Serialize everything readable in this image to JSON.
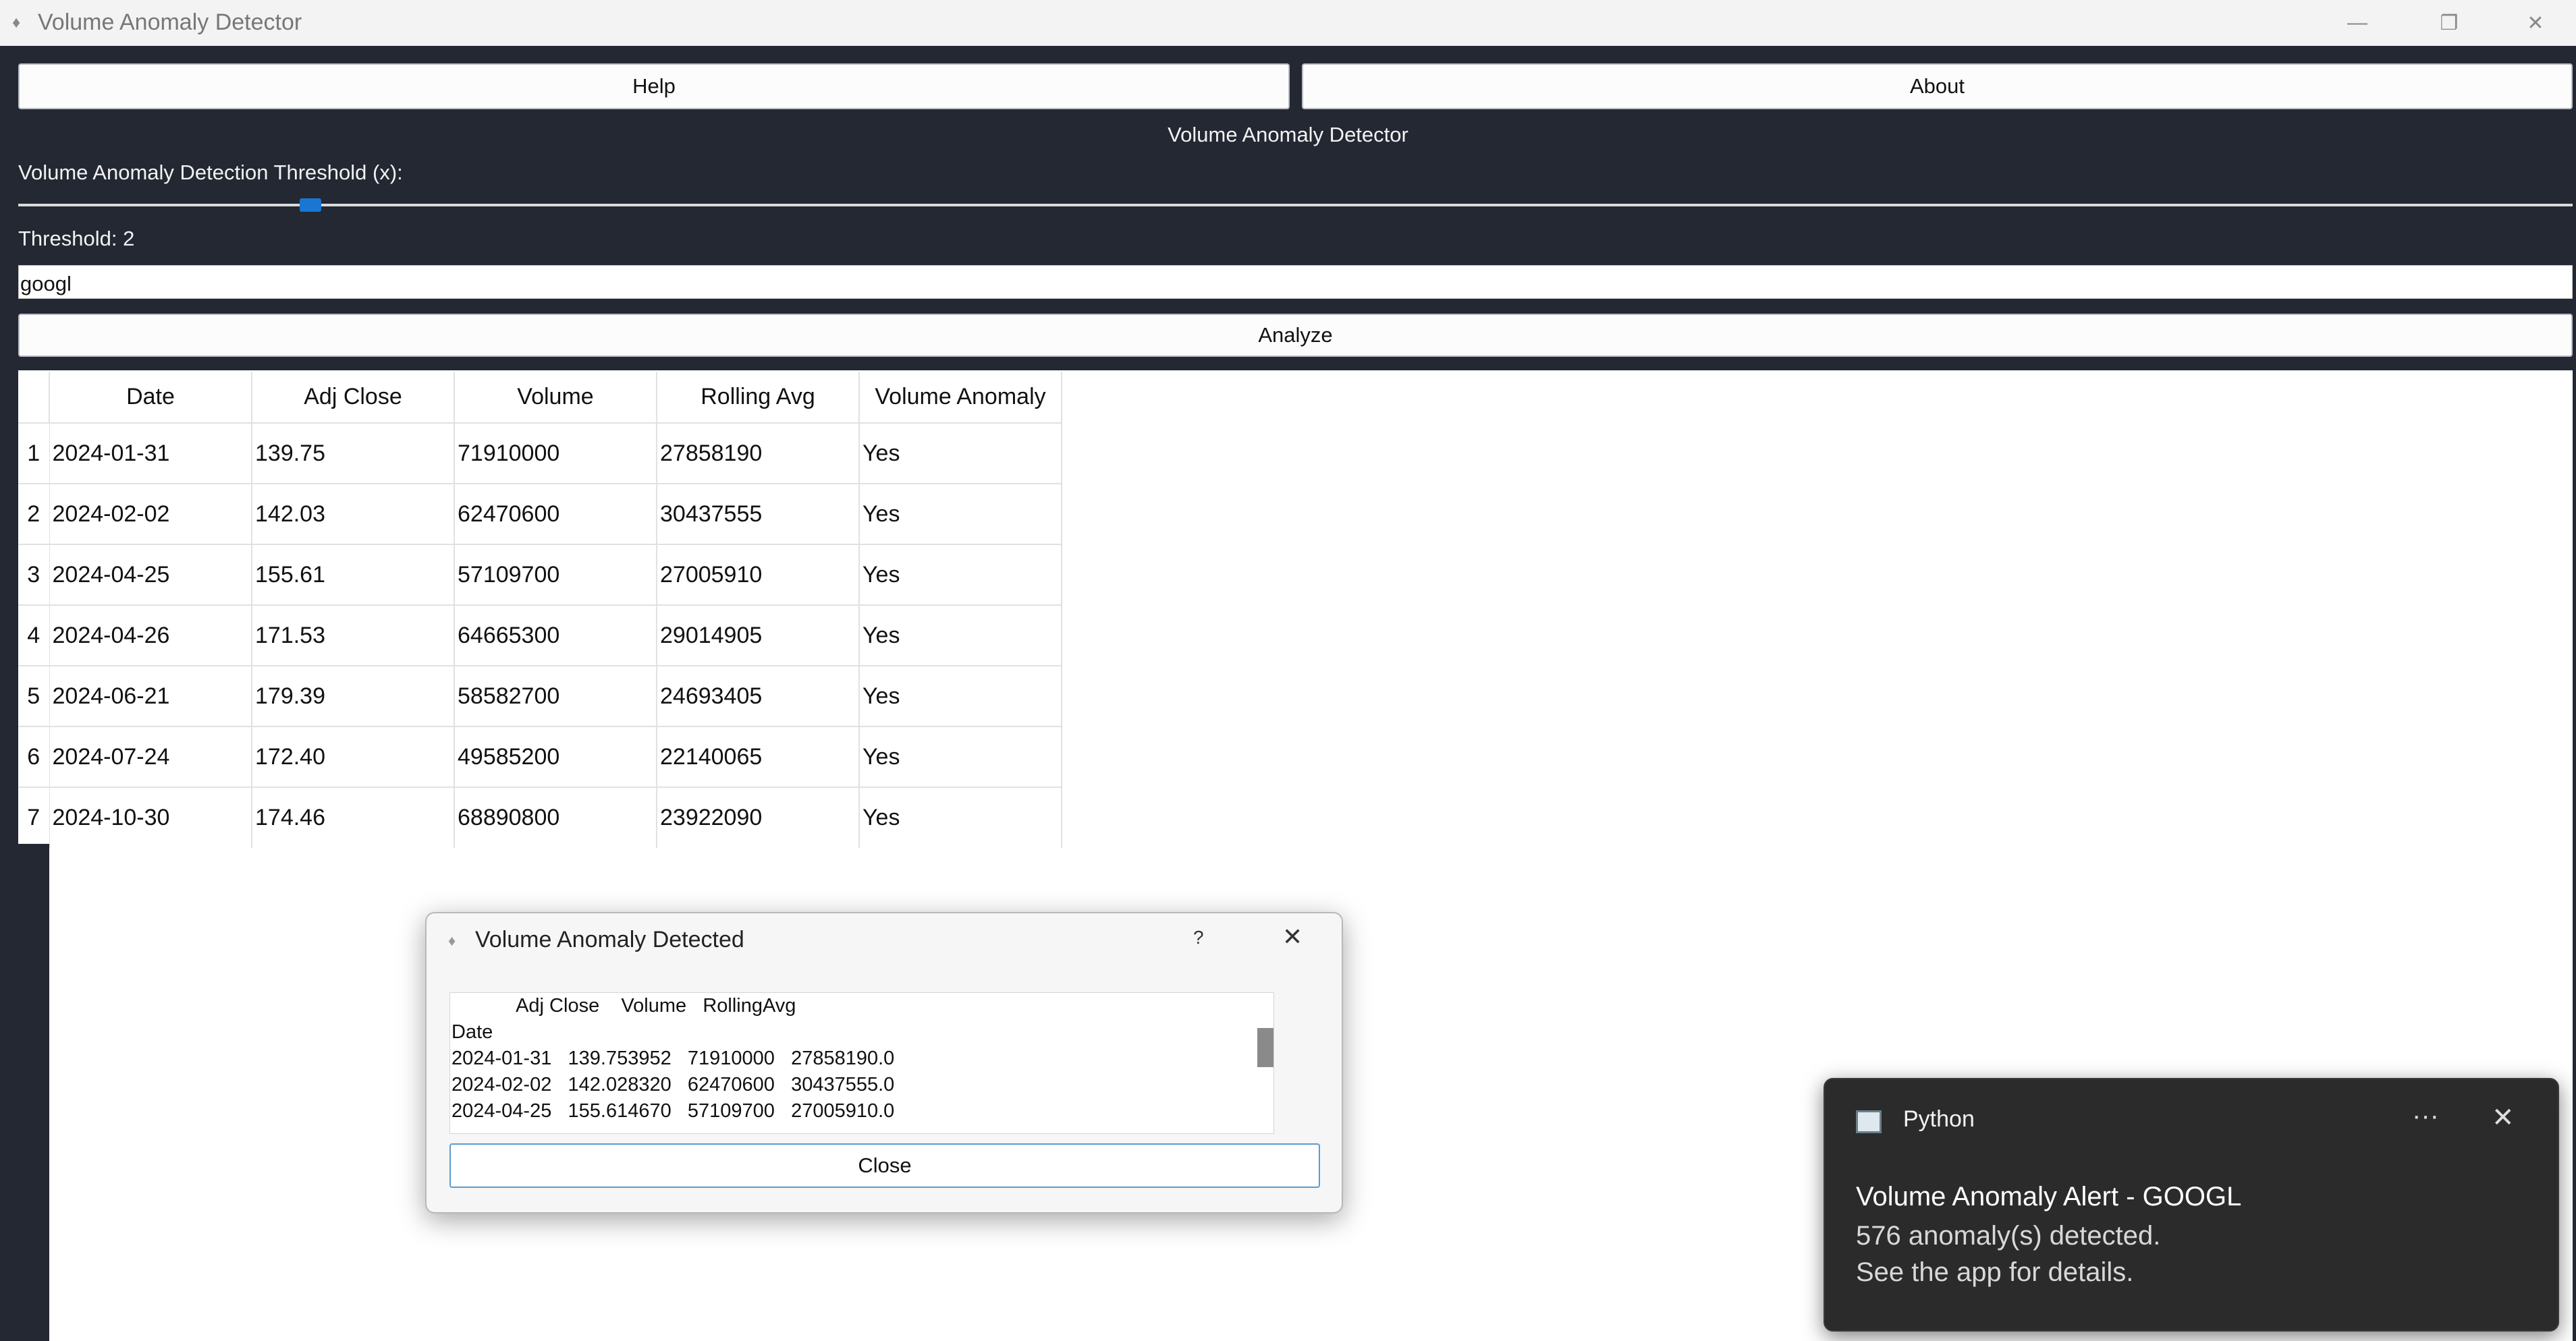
{
  "window": {
    "title": "Volume Anomaly Detector",
    "controls": {
      "minimize": "—",
      "restore": "❐",
      "close": "✕"
    }
  },
  "toolbar": {
    "help_label": "Help",
    "about_label": "About"
  },
  "header": {
    "title": "Volume Anomaly Detector"
  },
  "threshold": {
    "label": "Volume Anomaly Detection Threshold (x):",
    "value_text": "Threshold: 2",
    "value": 2
  },
  "ticker": {
    "value": "googl"
  },
  "analyze": {
    "label": "Analyze"
  },
  "table": {
    "headers": [
      "Date",
      "Adj Close",
      "Volume",
      "Rolling Avg",
      "Volume Anomaly"
    ],
    "rows": [
      {
        "num": "1",
        "cells": [
          "2024-01-31",
          "139.75",
          "71910000",
          "27858190",
          "Yes"
        ]
      },
      {
        "num": "2",
        "cells": [
          "2024-02-02",
          "142.03",
          "62470600",
          "30437555",
          "Yes"
        ]
      },
      {
        "num": "3",
        "cells": [
          "2024-04-25",
          "155.61",
          "57109700",
          "27005910",
          "Yes"
        ]
      },
      {
        "num": "4",
        "cells": [
          "2024-04-26",
          "171.53",
          "64665300",
          "29014905",
          "Yes"
        ]
      },
      {
        "num": "5",
        "cells": [
          "2024-06-21",
          "179.39",
          "58582700",
          "24693405",
          "Yes"
        ]
      },
      {
        "num": "6",
        "cells": [
          "2024-07-24",
          "172.40",
          "49585200",
          "22140065",
          "Yes"
        ]
      },
      {
        "num": "7",
        "cells": [
          "2024-10-30",
          "174.46",
          "68890800",
          "23922090",
          "Yes"
        ]
      }
    ]
  },
  "dialog": {
    "title": "Volume Anomaly Detected",
    "help": "?",
    "close_icon": "✕",
    "text": "            Adj Close    Volume   RollingAvg\nDate\n2024-01-31   139.753952   71910000   27858190.0\n2024-02-02   142.028320   62470600   30437555.0\n2024-04-25   155.614670   57109700   27005910.0",
    "close_label": "Close"
  },
  "toast": {
    "app": "Python",
    "more": "···",
    "close": "✕",
    "heading": "Volume Anomaly Alert - GOOGL",
    "line1": "576 anomaly(s) detected.",
    "line2": "See the app for details."
  }
}
